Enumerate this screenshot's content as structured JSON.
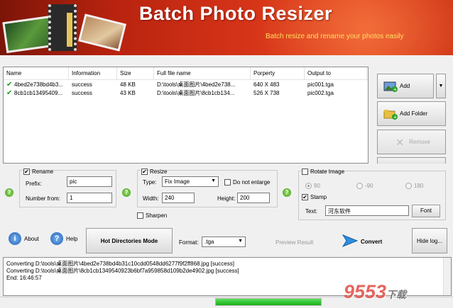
{
  "app": {
    "title": "Batch Photo Resizer",
    "subtitle": "Batch resize and rename your photos easily"
  },
  "filelist": {
    "columns": [
      "Name",
      "Information",
      "Size",
      "Full file name",
      "Porperty",
      "Output to"
    ],
    "rows": [
      {
        "name": "4bed2e738bd4b3...",
        "info": "success",
        "size": "48 KB",
        "full": "D:\\tools\\桌面图片\\4bed2e738...",
        "prop": "640 X 483",
        "out": "pic001.tga"
      },
      {
        "name": "8cb1cb13495409...",
        "info": "success",
        "size": "43 KB",
        "full": "D:\\tools\\桌面图片\\8cb1cb134...",
        "prop": "526 X 738",
        "out": "pic002.tga"
      }
    ]
  },
  "side_buttons": {
    "add": "Add",
    "add_folder": "Add Folder",
    "remove": "Remove",
    "dropdown": "▼"
  },
  "rename": {
    "label": "Rename",
    "prefix_label": "Prefix:",
    "prefix_value": "pic",
    "number_label": "Number from:",
    "number_value": "1"
  },
  "resize": {
    "label": "Resize",
    "type_label": "Type:",
    "type_value": "Fix Image",
    "no_enlarge": "Do not enlarge",
    "width_label": "Width:",
    "width_value": "240",
    "height_label": "Height:",
    "height_value": "200",
    "sharpen": "Sharpen"
  },
  "rotate": {
    "label": "Rotate Image",
    "options": [
      "90",
      "-90",
      "180"
    ]
  },
  "stamp": {
    "label": "Stamp",
    "text_label": "Text:",
    "text_value": "河东软件",
    "font_button": "Font"
  },
  "help_glyph": "?",
  "bottom": {
    "about": "About",
    "help": "Help",
    "hot_dirs": "Hot Directories Mode",
    "format_label": "Format:",
    "format_value": ".tga",
    "preview": "Preview Result",
    "convert": "Convert",
    "hide_log": "Hide log..."
  },
  "log": [
    "Converting D:\\tools\\桌面图片\\4bed2e738bd4b31c10cdd0548dd6277f9f2ff868.jpg [success]",
    "Converting D:\\tools\\桌面图片\\8cb1cb1349540923b6bf7a959858d109b2de4902.jpg [success]",
    "End: 16:46:57"
  ],
  "progress": 1.0,
  "watermark": {
    "main": "9553",
    "sub": "下载"
  },
  "colors": {
    "banner": "#c82a12",
    "subtitle": "#ffe060",
    "check": "#1e9a1e",
    "progress": "#16b016"
  }
}
